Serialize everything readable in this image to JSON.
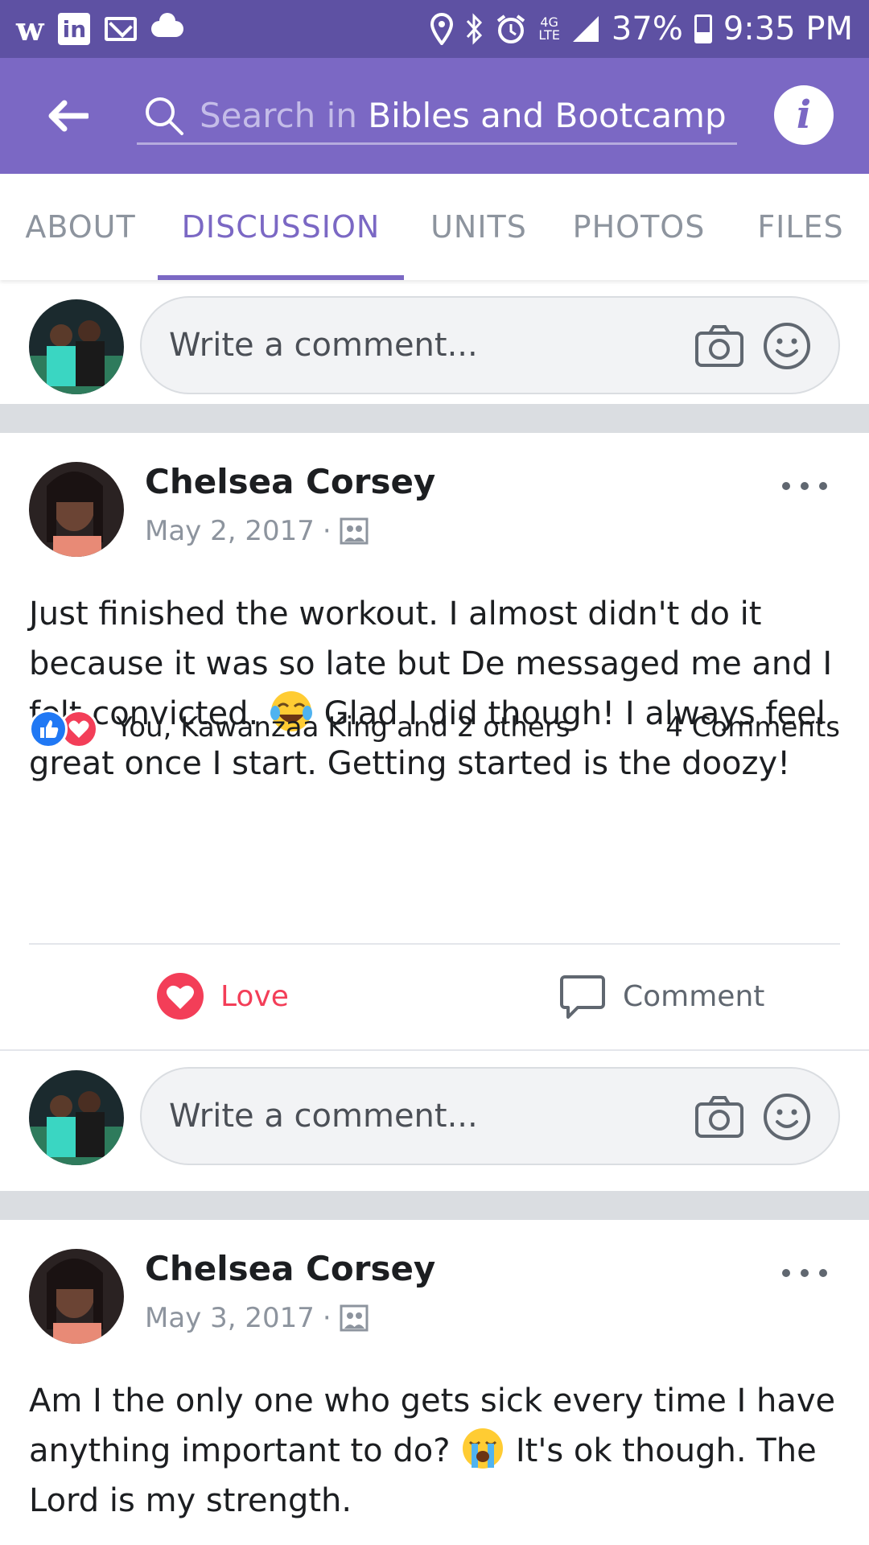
{
  "status_bar": {
    "battery": "37%",
    "time": "9:35 PM",
    "network": "4G LTE"
  },
  "header": {
    "search_prefix": "Search in ",
    "group_name": "Bibles and Bootcamp",
    "info_label": "i"
  },
  "tabs": [
    {
      "label": "ABOUT",
      "active": false
    },
    {
      "label": "DISCUSSION",
      "active": true
    },
    {
      "label": "UNITS",
      "active": false
    },
    {
      "label": "PHOTOS",
      "active": false
    },
    {
      "label": "FILES",
      "active": false
    }
  ],
  "composer": {
    "placeholder": "Write a comment..."
  },
  "posts": [
    {
      "author": "Chelsea Corsey",
      "date": "May 2, 2017",
      "text_before_emoji": "Just finished the workout. I almost didn't do it because it was so late but De messaged me and I felt convicted. ",
      "emoji": "face-with-tears-of-joy",
      "text_after_emoji": " Glad I did though! I always feel great once I start. Getting started is the doozy!",
      "reactions_text": "You, Kawanzaa King and 2 others",
      "comments_count": "4 Comments",
      "love_label": "Love",
      "comment_label": "Comment"
    },
    {
      "author": "Chelsea Corsey",
      "date": "May 3, 2017",
      "text_before_emoji": "Am I the only one who gets sick every time I have anything important to do? ",
      "emoji": "loudly-crying-face",
      "text_after_emoji": " It's ok though. The Lord is my strength."
    }
  ],
  "colors": {
    "status_bar": "#5e51a3",
    "header": "#7b68c4",
    "love": "#f33e58",
    "like": "#2078f4"
  }
}
